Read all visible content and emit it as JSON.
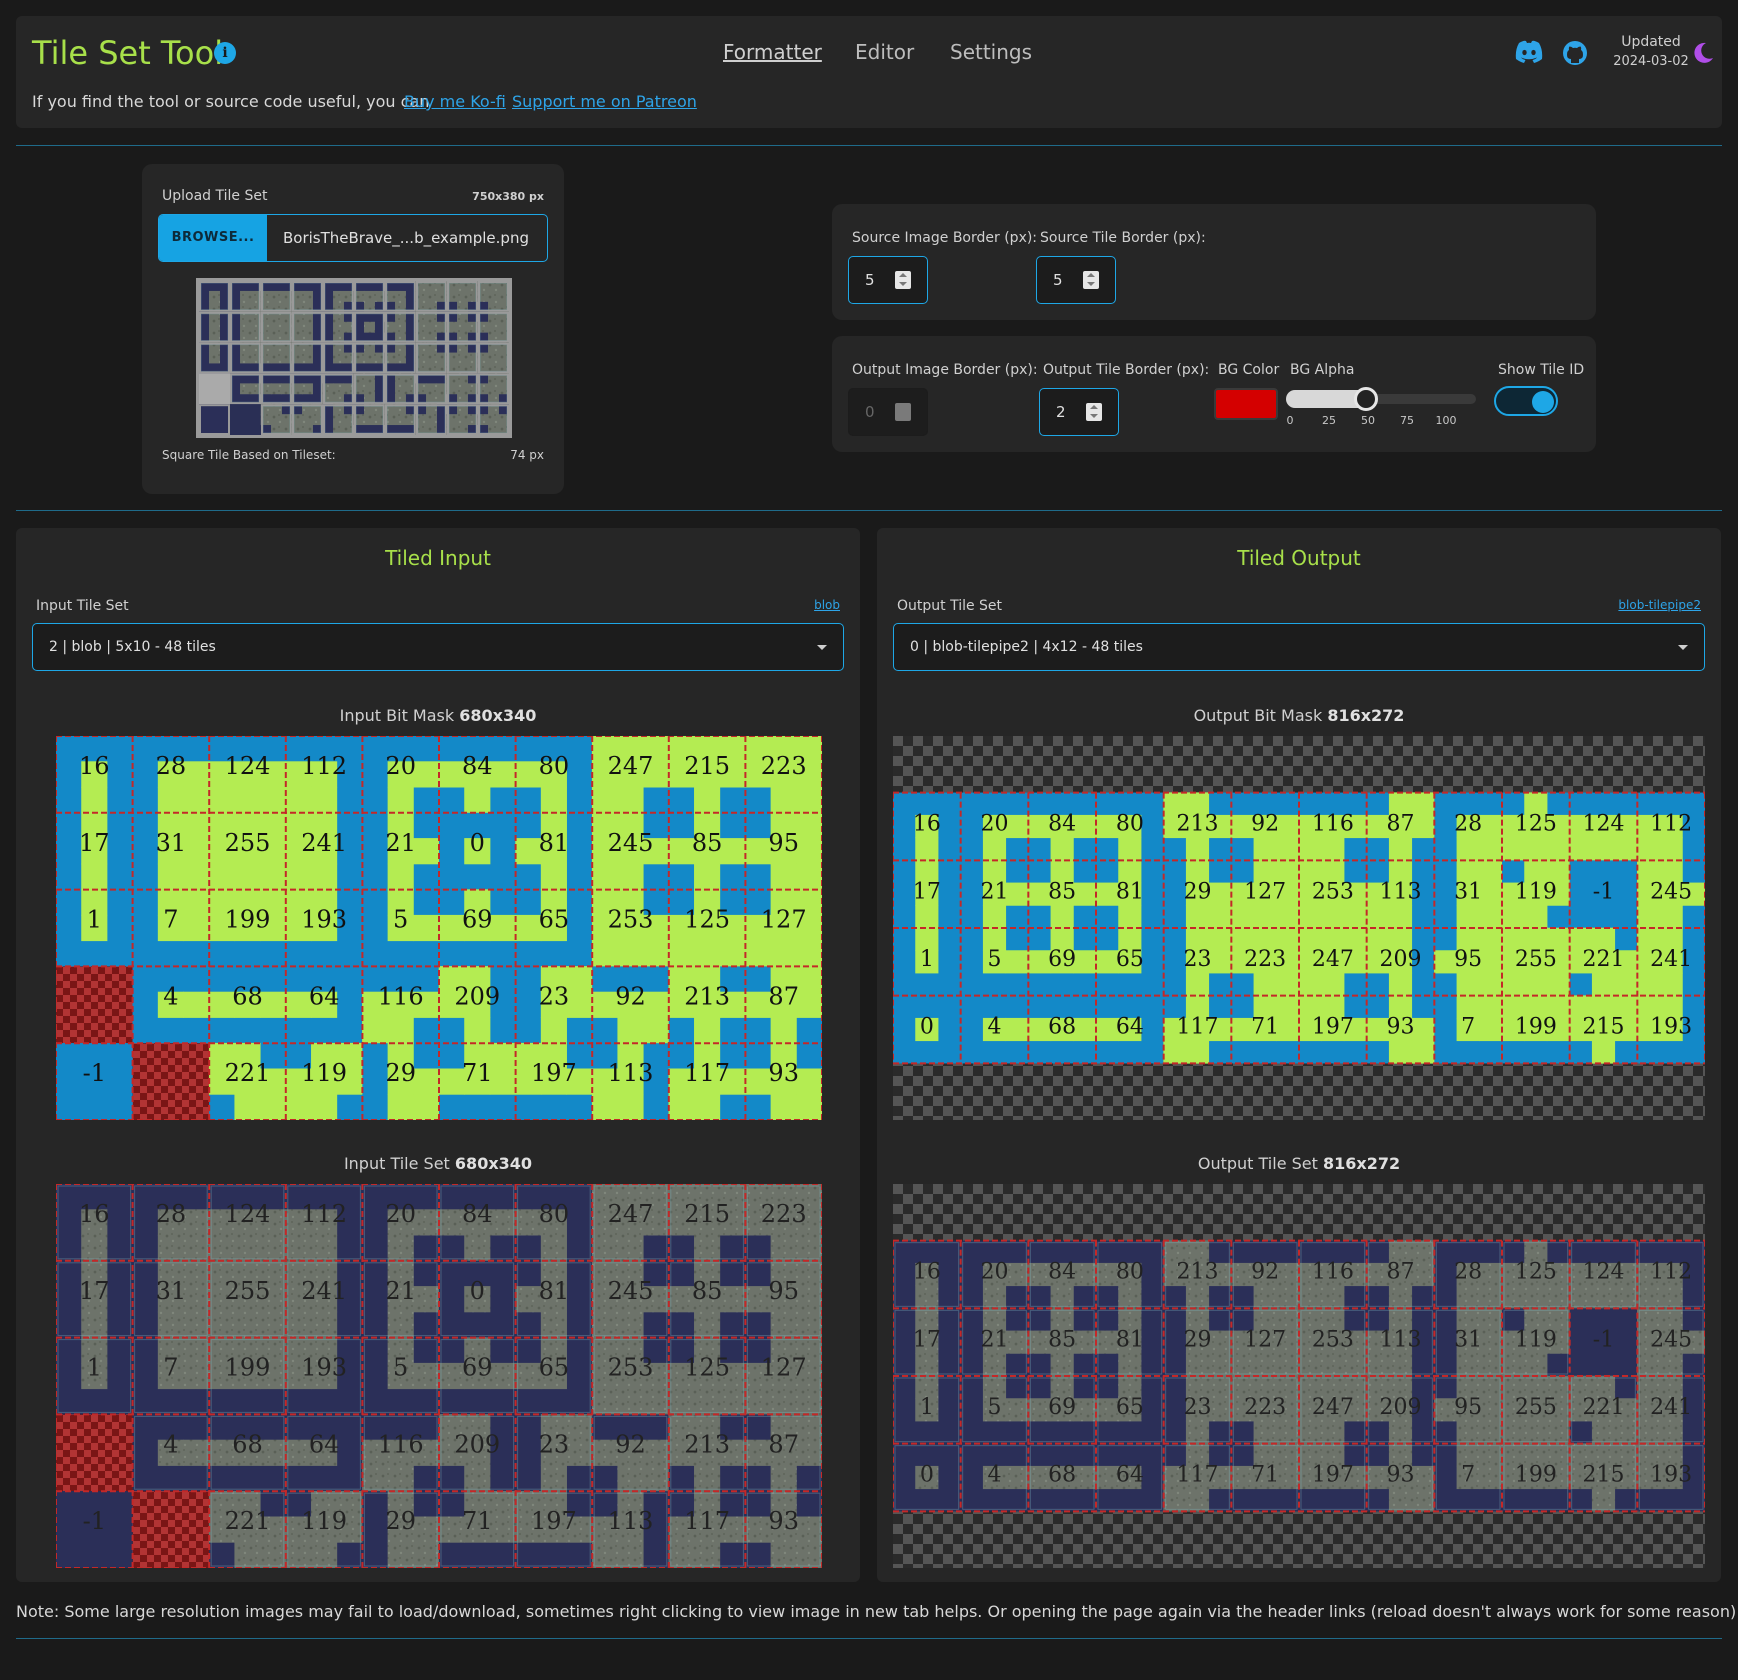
{
  "header": {
    "title": "Tile Set Tool",
    "info_icon": "info-icon",
    "nav": [
      "Formatter",
      "Editor",
      "Settings"
    ],
    "updated_label": "Updated",
    "updated_date": "2024-03-02",
    "support_text": "If you find the tool or source code useful, you can",
    "kofi_link": "Buy me Ko-fi",
    "patreon_link": "Support me on Patreon"
  },
  "upload": {
    "label": "Upload Tile Set",
    "size": "750x380 px",
    "browse_label": "BROWSE...",
    "file_name": "BorisTheBrave_...b_example.png",
    "square_label": "Square Tile Based on Tileset:",
    "square_value": "74 px"
  },
  "source_borders": {
    "image_border_label": "Source Image Border (px):",
    "image_border_value": "5",
    "tile_border_label": "Source Tile Border (px):",
    "tile_border_value": "5"
  },
  "output_borders": {
    "image_border_label": "Output Image Border (px):",
    "image_border_value": "0",
    "tile_border_label": "Output Tile Border (px):",
    "tile_border_value": "2",
    "bg_color_label": "BG Color",
    "bg_color": "#d40000",
    "bg_alpha_label": "BG Alpha",
    "bg_alpha_value": 50,
    "bg_alpha_ticks": [
      "0",
      "25",
      "50",
      "75",
      "100"
    ],
    "show_tile_id_label": "Show Tile ID",
    "show_tile_id": true
  },
  "input_panel": {
    "title": "Tiled Input",
    "select_label": "Input Tile Set",
    "select_link": "blob",
    "select_value": "2 | blob | 5x10 - 48 tiles",
    "bitmask_caption": "Input Bit Mask",
    "bitmask_size": "680x340",
    "tileset_caption": "Input Tile Set",
    "tileset_size": "680x340",
    "grid": {
      "cols": 10,
      "rows": 5,
      "ids": [
        [
          16,
          28,
          124,
          112,
          20,
          84,
          80,
          247,
          215,
          223
        ],
        [
          17,
          31,
          255,
          241,
          21,
          0,
          81,
          245,
          85,
          95
        ],
        [
          1,
          7,
          199,
          193,
          5,
          69,
          65,
          253,
          125,
          127
        ],
        [
          null,
          4,
          68,
          64,
          116,
          209,
          23,
          92,
          213,
          87
        ],
        [
          -1,
          null,
          221,
          119,
          29,
          71,
          197,
          113,
          117,
          93
        ]
      ]
    }
  },
  "output_panel": {
    "title": "Tiled Output",
    "select_label": "Output Tile Set",
    "select_link": "blob-tilepipe2",
    "select_value": "0 | blob-tilepipe2 | 4x12 - 48 tiles",
    "bitmask_caption": "Output Bit Mask",
    "bitmask_size": "816x272",
    "tileset_caption": "Output Tile Set",
    "tileset_size": "816x272",
    "grid": {
      "cols": 12,
      "rows": 4,
      "ids": [
        [
          16,
          20,
          84,
          80,
          213,
          92,
          116,
          87,
          28,
          125,
          124,
          112
        ],
        [
          17,
          21,
          85,
          81,
          29,
          127,
          253,
          113,
          31,
          119,
          -1,
          245
        ],
        [
          1,
          5,
          69,
          65,
          23,
          223,
          247,
          209,
          95,
          255,
          221,
          241
        ],
        [
          0,
          4,
          68,
          64,
          117,
          71,
          197,
          93,
          7,
          199,
          215,
          193
        ]
      ]
    }
  },
  "colors": {
    "accent": "#a8e04a",
    "link": "#2ea4e8",
    "mask_fill": "#b4ec52",
    "mask_empty": "#1389c8",
    "grid_line": "#c42828",
    "water": "#2b2f58",
    "rock": "#6d736a"
  },
  "footer_note": "Note: Some large resolution images may fail to load/download, sometimes right clicking to view image in new tab helps. Or opening the page again via the header links (reload doesn't always work for some reason)"
}
